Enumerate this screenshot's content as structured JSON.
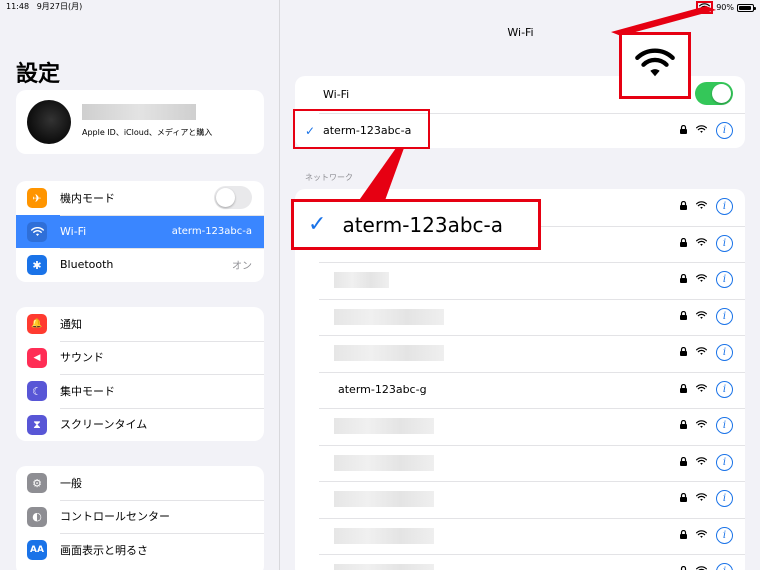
{
  "status": {
    "time": "11:48",
    "date": "9月27日(月)",
    "battery": "90%"
  },
  "sidebar": {
    "title": "設定",
    "profile_sub": "Apple ID、iCloud、メディアと購入",
    "group1": [
      {
        "label": "機内モード",
        "icon": "airplane-icon",
        "color": "#ff9500",
        "glyph": "✈"
      },
      {
        "label": "Wi-Fi",
        "value": "aterm-123abc-a",
        "icon": "wifi-icon",
        "color": "#1a73e8"
      },
      {
        "label": "Bluetooth",
        "value": "オン",
        "icon": "bluetooth-icon",
        "color": "#1a73e8",
        "glyph": "✱"
      }
    ],
    "group2": [
      {
        "label": "通知",
        "icon": "bell-icon",
        "color": "#ff3b30",
        "glyph": "🔔"
      },
      {
        "label": "サウンド",
        "icon": "speaker-icon",
        "color": "#ff2d55",
        "glyph": "◀"
      },
      {
        "label": "集中モード",
        "icon": "moon-icon",
        "color": "#5856d6",
        "glyph": "☾"
      },
      {
        "label": "スクリーンタイム",
        "icon": "hourglass-icon",
        "color": "#5856d6",
        "glyph": "⧗"
      }
    ],
    "group3": [
      {
        "label": "一般",
        "icon": "gear-icon",
        "color": "#8e8e93",
        "glyph": "⚙"
      },
      {
        "label": "コントロールセンター",
        "icon": "toggles-icon",
        "color": "#8e8e93",
        "glyph": "◐"
      },
      {
        "label": "画面表示と明るさ",
        "icon": "text-size-icon",
        "color": "#1a73e8",
        "glyph": "AA"
      }
    ]
  },
  "main": {
    "title": "Wi-Fi",
    "wifi_label": "Wi-Fi",
    "connected": "aterm-123abc-a",
    "section": "ネットワーク",
    "network_named": "aterm-123abc-g",
    "check": "✓",
    "info": "i"
  },
  "callout": {
    "network": "aterm-123abc-a",
    "check": "✓"
  },
  "colors": {
    "accent": "#1a73e8",
    "highlight": "#e60012",
    "toggle_on": "#34c759"
  }
}
